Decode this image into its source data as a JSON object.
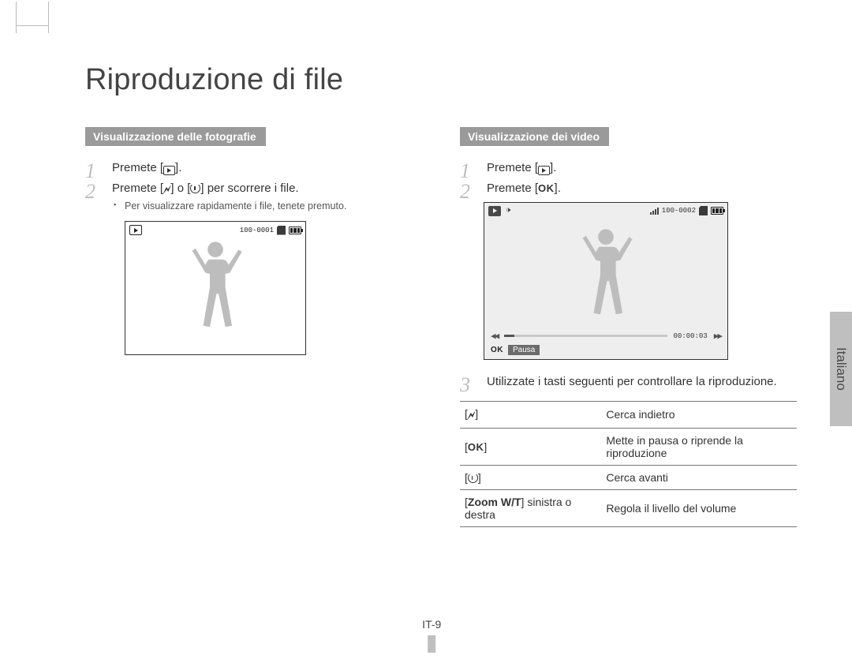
{
  "title": "Riproduzione di file",
  "language_tab": "Italiano",
  "page_number": "IT-9",
  "photo_section": {
    "heading": "Visualizzazione delle fotografie",
    "step1_a": "Premete [",
    "step1_b": "].",
    "step2_a": "Premete [",
    "step2_b": "] o [",
    "step2_c": "] per scorrere i file.",
    "sub": "Per visualizzare rapidamente i file, tenete premuto.",
    "lcd_counter": "100-0001"
  },
  "video_section": {
    "heading": "Visualizzazione dei video",
    "step1_a": "Premete [",
    "step1_b": "].",
    "step2_a": "Premete [",
    "step2_b": "].",
    "step3": "Utilizzate i tasti seguenti per controllare la riproduzione.",
    "lcd_counter": "100-0002",
    "lcd_time": "00:00:03",
    "lcd_pause": "Pausa",
    "ok_label": "OK",
    "controls": [
      {
        "key_type": "flash",
        "desc": "Cerca indietro"
      },
      {
        "key_type": "ok",
        "desc": "Mette in pausa o riprende la riproduzione"
      },
      {
        "key_type": "timer",
        "desc": "Cerca avanti"
      },
      {
        "key_type": "zoom",
        "key_text_a": "Zoom W/T",
        "key_text_b": " sinistra o destra",
        "desc": "Regola il livello del volume"
      }
    ]
  },
  "icons": {
    "play": "play-icon",
    "flash": "⯈",
    "ok": "OK"
  }
}
